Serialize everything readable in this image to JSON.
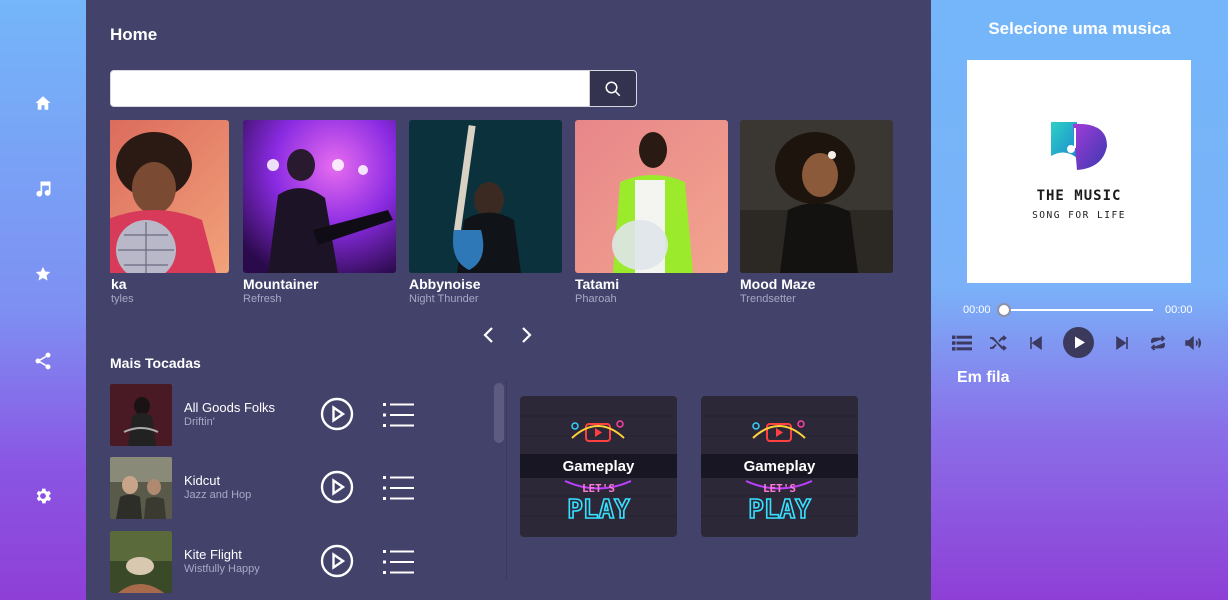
{
  "nav": {
    "items": [
      {
        "icon": "home-icon"
      },
      {
        "icon": "music-note-icon"
      },
      {
        "icon": "star-icon"
      },
      {
        "icon": "share-icon"
      },
      {
        "icon": "gear-icon"
      }
    ]
  },
  "main": {
    "title": "Home",
    "search": {
      "value": "",
      "placeholder": "",
      "button_icon": "search-icon"
    },
    "carousel": [
      {
        "title": "ka",
        "subtitle": "tyles"
      },
      {
        "title": "Mountainer",
        "subtitle": "Refresh"
      },
      {
        "title": "Abbynoise",
        "subtitle": "Night Thunder"
      },
      {
        "title": "Tatami",
        "subtitle": "Pharoah"
      },
      {
        "title": "Mood Maze",
        "subtitle": "Trendsetter"
      }
    ],
    "carousel_nav": {
      "prev_icon": "chevron-left-icon",
      "next_icon": "chevron-right-icon"
    },
    "most_played_title": "Mais Tocadas",
    "tracks": [
      {
        "name": "All Goods Folks",
        "artist": "Driftin'"
      },
      {
        "name": "Kidcut",
        "artist": "Jazz and Hop"
      },
      {
        "name": "Kite Flight",
        "artist": "Wistfully Happy"
      }
    ],
    "games": [
      {
        "label": "Gameplay",
        "art_text_1": "LET'S",
        "art_text_2": "PLAY"
      },
      {
        "label": "Gameplay",
        "art_text_1": "LET'S",
        "art_text_2": "PLAY"
      }
    ]
  },
  "player": {
    "title": "Selecione uma musica",
    "cover": {
      "logo_main": "THE MUSIC",
      "logo_sub": "SONG FOR LIFE"
    },
    "current_time": "00:00",
    "total_time": "00:00",
    "progress": 0,
    "queue_title": "Em fila"
  },
  "colors": {
    "main_bg": "#43426b",
    "sidebar_gradient_top": "#74b6f9",
    "sidebar_gradient_bottom": "#8f3fd6",
    "dark_button": "#3b3a5c"
  }
}
